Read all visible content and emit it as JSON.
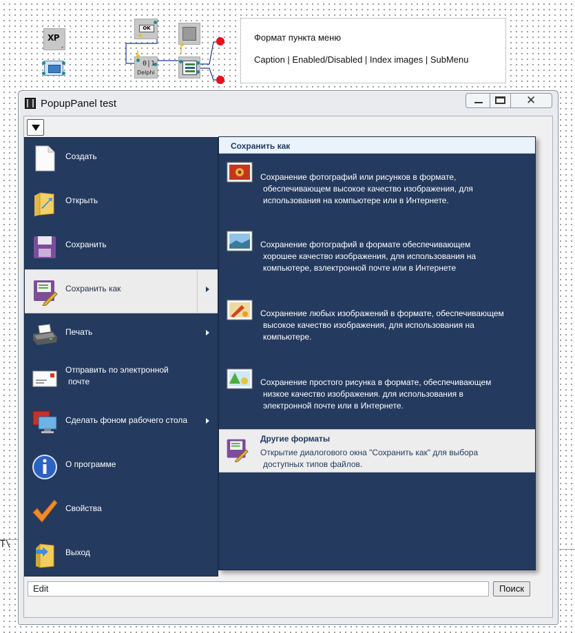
{
  "canvas": {
    "components": {
      "xp_label": "XP",
      "ok_label": "OK",
      "delphi_glyph": "0|1",
      "delphi_label": "Delphi"
    },
    "note": {
      "line1": "Формат пункта меню",
      "line2": "Caption | Enabled/Disabled | Index images | SubMenu"
    },
    "edge_fragment": "T\\"
  },
  "window": {
    "title": "PopupPanel test",
    "title_icon": "film-icon",
    "controls": {
      "minimize": "minimize-icon",
      "maximize": "maximize-icon",
      "close_glyph": "✕"
    }
  },
  "toolbar": {
    "dropdown_icon": "triangle-down-icon"
  },
  "menu": {
    "items": [
      {
        "label": "Создать",
        "icon": "new-document-icon",
        "submenu": false
      },
      {
        "label": "Открыть",
        "icon": "open-folder-icon",
        "submenu": false
      },
      {
        "label": "Сохранить",
        "icon": "floppy-disk-icon",
        "submenu": false
      },
      {
        "label": "Сохранить как",
        "icon": "save-as-icon",
        "submenu": true,
        "highlighted": true
      },
      {
        "label": "Печать",
        "icon": "printer-icon",
        "submenu": true
      },
      {
        "label_line1": "Отправить по электронной",
        "label_line2": "почте",
        "icon": "envelope-icon",
        "submenu": false
      },
      {
        "label": "Сделать фоном рабочего стола",
        "icon": "desktop-icon",
        "submenu": true
      },
      {
        "label": "О программе",
        "icon": "info-icon",
        "submenu": false
      },
      {
        "label": "Свойства",
        "icon": "checkmark-icon",
        "submenu": false
      },
      {
        "label": "Выход",
        "icon": "exit-icon",
        "submenu": false
      }
    ]
  },
  "submenu": {
    "header": "Сохранить как",
    "items": [
      {
        "icon": "jpeg-icon",
        "lines": [
          "Сохранение фотографий или рисунков в формате,",
          "обеспечивающем высокое качество изображения, для",
          "использования на компьютере или в Интернете."
        ]
      },
      {
        "icon": "png-photo-icon",
        "lines": [
          "Сохранение фотографий в формате обеспечивающем",
          "хорошее качество изображения, для использования на",
          "компьютере, взлектронной почте или в Интернете"
        ]
      },
      {
        "icon": "bmp-image-icon",
        "lines": [
          "Сохранение любых изображений в формате, обеспечивающем",
          "высокое качество изображения, для использования на",
          "компьютере."
        ]
      },
      {
        "icon": "gif-drawing-icon",
        "lines": [
          "Сохранение простого рисунка в формате, обеспечивающем",
          "низкое качество изображения. для использования в",
          "электронной почте или в Интернете."
        ]
      }
    ],
    "other": {
      "icon": "save-as-icon",
      "title": "Другие форматы",
      "lines": [
        "Открытие диалогового окна \"Сохранить как\" для выбора",
        "доступных типов файлов."
      ]
    }
  },
  "footer": {
    "edit_value": "Edit",
    "search_label": "Поиск"
  },
  "colors": {
    "menu_bg": "#243a5e",
    "highlight_bg": "#ececec",
    "window_bg": "#f0f0f0"
  }
}
